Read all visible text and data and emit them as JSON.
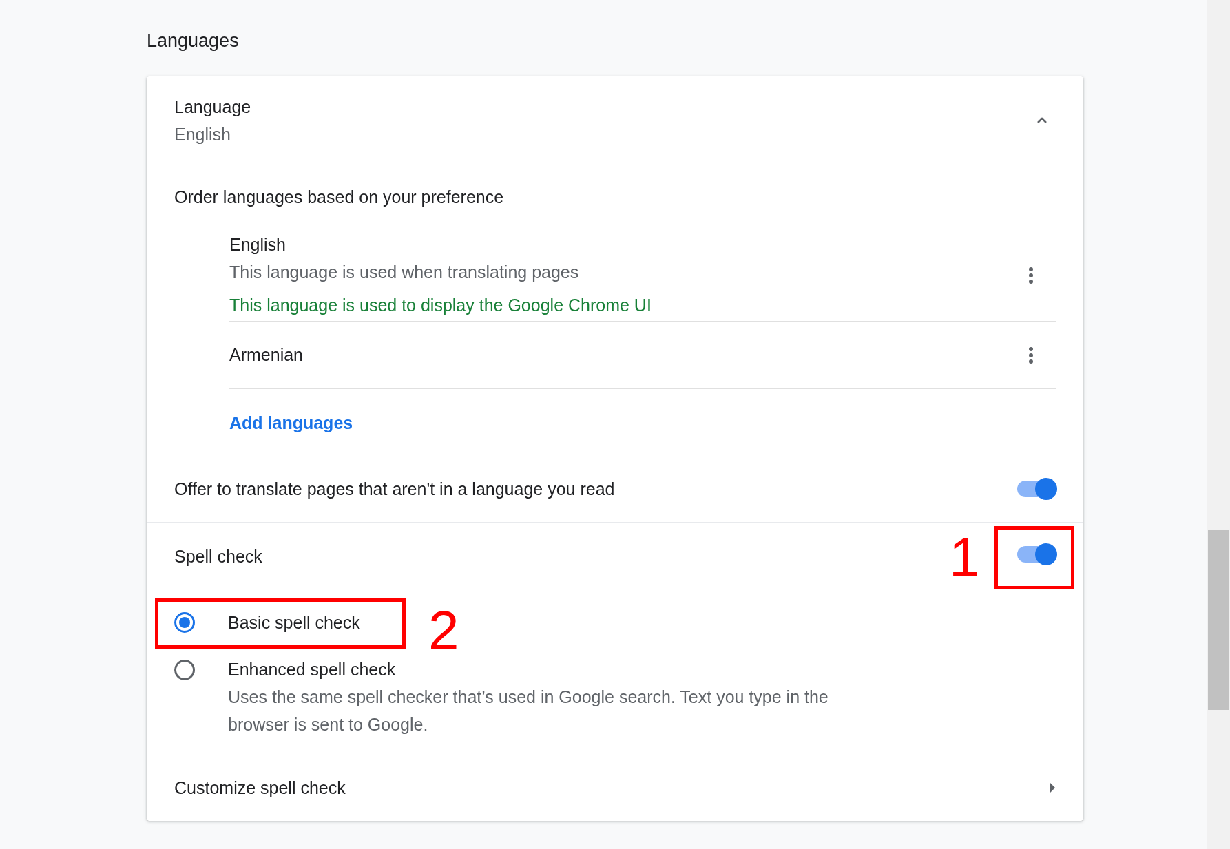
{
  "section_title": "Languages",
  "language": {
    "label": "Language",
    "value": "English",
    "expanded": true
  },
  "order_label": "Order languages based on your preference",
  "languages": [
    {
      "name": "English",
      "notes": [
        {
          "text": "This language is used when translating pages",
          "kind": "info"
        },
        {
          "text": "This language is used to display the Google Chrome UI",
          "kind": "ui"
        }
      ]
    },
    {
      "name": "Armenian"
    }
  ],
  "add_languages": "Add languages",
  "offer_translate": {
    "label": "Offer to translate pages that aren't in a language you read",
    "on": true
  },
  "spell_check": {
    "label": "Spell check",
    "on": true,
    "options": [
      {
        "label": "Basic spell check",
        "selected": true
      },
      {
        "label": "Enhanced spell check",
        "description": "Uses the same spell checker that’s used in Google search. Text you type in the browser is sent to Google.",
        "selected": false
      }
    ]
  },
  "customize": "Customize spell check",
  "annotations": [
    {
      "label": "1"
    },
    {
      "label": "2"
    }
  ]
}
